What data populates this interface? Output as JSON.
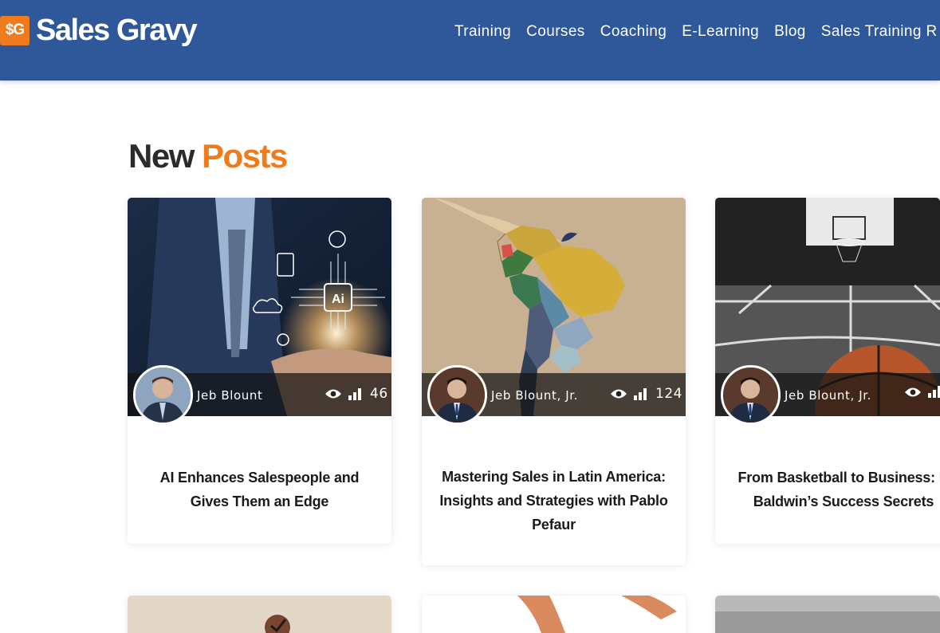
{
  "header": {
    "logo_mark": "$G",
    "logo_text": "Sales Gravy",
    "nav": [
      "Training",
      "Courses",
      "Coaching",
      "E-Learning",
      "Blog",
      "Sales Training R"
    ]
  },
  "section": {
    "title_part1": "New",
    "title_part2": "Posts"
  },
  "posts": [
    {
      "author": "Jeb Blount",
      "views": "46",
      "title": "AI Enhances Salespeople and Gives Them an Edge"
    },
    {
      "author": "Jeb Blount, Jr.",
      "views": "124",
      "title": "Mastering Sales in Latin America: Insights and Strategies with Pablo Pefaur"
    },
    {
      "author": "Jeb Blount, Jr.",
      "views": "",
      "title": "From Basketball to Business: D Baldwin’s Success Secrets"
    }
  ],
  "colors": {
    "header_bg": "#2e5899",
    "accent": "#f07b1c"
  },
  "icons": [
    "eye-icon",
    "bar-chart-icon"
  ]
}
